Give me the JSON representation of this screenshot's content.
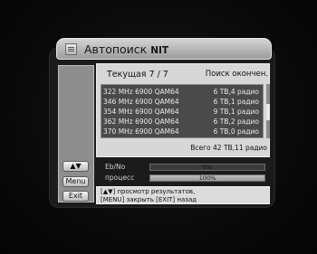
{
  "window": {
    "title_prefix": "Автопоиск",
    "title_suffix": "NIT",
    "title_icon": "list-icon"
  },
  "sidebar": {
    "arrows_label": "▲▼",
    "menu_label": "Menu",
    "exit_label": "Exit"
  },
  "scan": {
    "current_label": "Текущая 7 / 7",
    "status_text": "Поиск окончен.",
    "results": [
      {
        "frequency": "322 MHz 6900 QAM64",
        "result": "6 ТВ,4 радио"
      },
      {
        "frequency": "346 MHz 6900 QAM64",
        "result": "6 ТВ,1 радио"
      },
      {
        "frequency": "354 MHz 6900 QAM64",
        "result": "9 ТВ,1 радио"
      },
      {
        "frequency": "362 MHz 6900 QAM64",
        "result": "6 ТВ,2 радио"
      },
      {
        "frequency": "370 MHz 6900 QAM64",
        "result": "6 ТВ,0 радио"
      }
    ],
    "total_text": "Всего 42 ТВ,11 радио"
  },
  "signal": {
    "ebno_label": "Eb/No",
    "ebno_value": "0%",
    "ebno_fraction": 0,
    "progress_label": "процесс",
    "progress_value": "100%",
    "progress_fraction": 1
  },
  "help": {
    "line1": "[▲▼] просмотр результатов,",
    "line2": "[MENU] закрыть [EXIT] назад"
  }
}
